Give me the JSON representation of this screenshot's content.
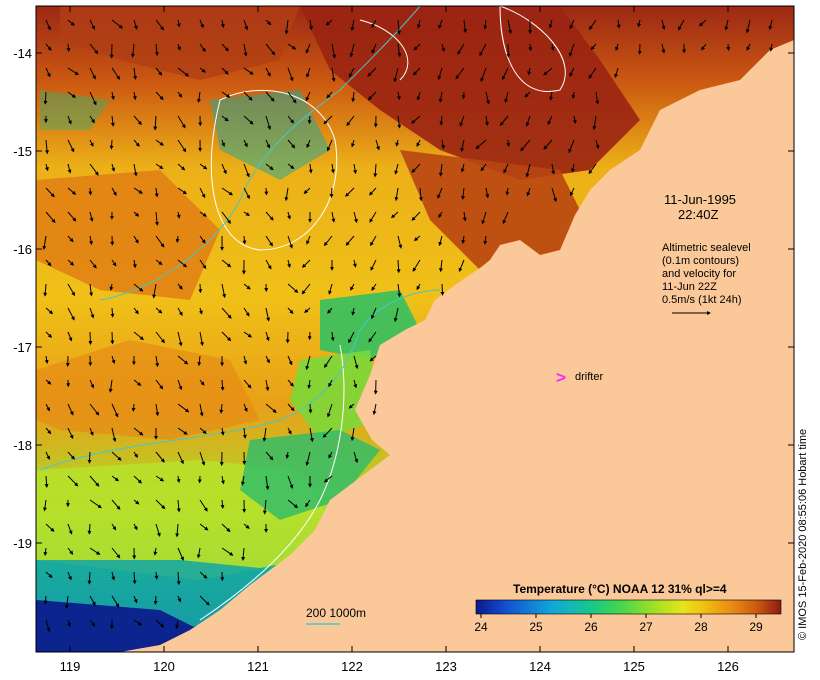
{
  "map": {
    "product": "Temperature (°C) NOAA 12 31% ql>=4",
    "colorbar_ticks": [
      "24",
      "25",
      "26",
      "27",
      "28",
      "29"
    ],
    "colorbar_colors": [
      "#0a1a8c",
      "#1450d2",
      "#10a8d8",
      "#18c88a",
      "#4ad64a",
      "#9de026",
      "#e8e41c",
      "#f2b810",
      "#e88a14",
      "#cc5a10",
      "#a83414",
      "#8a1c14"
    ],
    "date_line1": "11-Jun-1995",
    "date_line2": "22:40Z",
    "legend_note_lines": [
      "Altimetric sealevel",
      "(0.1m contours)",
      "and velocity for",
      "11-Jun 22Z",
      "0.5m/s (1kt 24h)"
    ],
    "drifter_label": "drifter",
    "drifter_marker": ">",
    "drifter_color": "#ff22ff",
    "bathymetry_label": "200  1000m",
    "bathymetry_color": "#44c8c8",
    "land_color": "#fbc89a",
    "x_ticks": [
      "119",
      "120",
      "121",
      "122",
      "123",
      "124",
      "125",
      "126"
    ],
    "y_ticks": [
      "-14",
      "-15",
      "-16",
      "-17",
      "-18",
      "-19"
    ],
    "copyright": "© IMOS 15-Feb-2020 08:55:06 Hobart time"
  }
}
